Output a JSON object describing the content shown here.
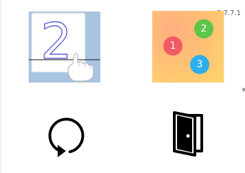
{
  "app": {
    "version": "2.7.7.1"
  },
  "menu": {
    "write_tile": {
      "digit": "2",
      "icon": "handwriting-digit-icon"
    },
    "count_tile": {
      "icon": "counting-balls-icon",
      "balls": [
        {
          "label": "1",
          "color": "#f05a63"
        },
        {
          "label": "2",
          "color": "#5ec64b"
        },
        {
          "label": "3",
          "color": "#2eaeea"
        }
      ]
    },
    "restart_button": {
      "icon": "restart-icon"
    },
    "exit_button": {
      "icon": "exit-door-icon"
    }
  }
}
